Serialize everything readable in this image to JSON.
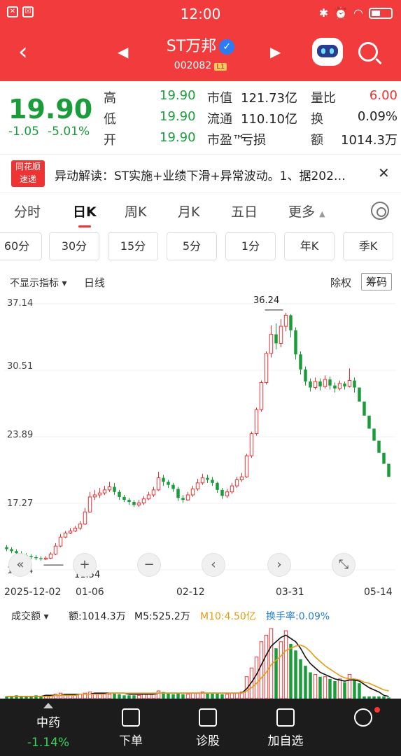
{
  "status_bar": {
    "time": "12:00",
    "left_icons": [
      "✕",
      "☒"
    ],
    "right_icons": [
      "bluetooth-icon",
      "alarm-icon",
      "wifi-icon",
      "battery-icon"
    ]
  },
  "nav": {
    "title": "ST万邦",
    "code": "002082",
    "level": "L1"
  },
  "quote": {
    "price": "19.90",
    "change": "-1.05",
    "change_pct": "-5.01%",
    "rows": [
      {
        "k1": "高",
        "v1": "19.90",
        "k2": "市值",
        "v2": "121.73亿",
        "k3": "量比",
        "v3": "6.00",
        "v3_red": true
      },
      {
        "k1": "低",
        "v1": "19.90",
        "k2": "流通",
        "v2": "110.10亿",
        "k3": "换",
        "v3": "0.09%",
        "v3_red": false
      },
      {
        "k1": "开",
        "v1": "19.90",
        "k2": "市盈™",
        "v2": "亏损",
        "k3": "额",
        "v3": "1014.3万",
        "v3_red": false
      }
    ]
  },
  "news": {
    "logo_top": "同花顺",
    "logo_bottom": "速递",
    "text": "异动解读：ST实施+业绩下滑+异常波动。1、据202…",
    "close": "✕"
  },
  "period_tabs": [
    "分时",
    "日K",
    "周K",
    "月K",
    "五日",
    "更多"
  ],
  "more_caret": "▲",
  "minute_buttons": [
    "60分",
    "30分",
    "15分",
    "5分",
    "1分",
    "年K",
    "季K"
  ],
  "chart_head": {
    "indicator": "不显示指标 ▾",
    "ma": "日线",
    "exright": "除权",
    "chips": "筹码"
  },
  "chart_data": {
    "type": "candlestick",
    "y_ticks": [
      "37.14",
      "30.51",
      "23.89",
      "17.27",
      "10.64"
    ],
    "ylim": [
      10.64,
      37.14
    ],
    "x_ticks": [
      "2025-12-02",
      "01-06",
      "02-12",
      "03-31",
      "05-14"
    ],
    "max_label": "36.24",
    "min_label": "11.54",
    "candles": [
      [
        12.9,
        12.7,
        13.1,
        12.5
      ],
      [
        12.7,
        12.5,
        12.9,
        12.3
      ],
      [
        12.5,
        12.3,
        12.7,
        12.1
      ],
      [
        12.3,
        12.1,
        12.5,
        11.9
      ],
      [
        12.1,
        12.0,
        12.3,
        11.8
      ],
      [
        12.0,
        11.9,
        12.2,
        11.7
      ],
      [
        11.9,
        11.8,
        12.1,
        11.6
      ],
      [
        11.8,
        11.7,
        12.0,
        11.54
      ],
      [
        11.7,
        11.8,
        12.0,
        11.6
      ],
      [
        11.8,
        12.2,
        12.4,
        11.7
      ],
      [
        12.2,
        13.0,
        13.3,
        12.1
      ],
      [
        13.0,
        13.9,
        14.2,
        12.9
      ],
      [
        13.9,
        14.3,
        14.5,
        13.8
      ],
      [
        14.3,
        14.5,
        14.8,
        14.2
      ],
      [
        14.5,
        14.8,
        15.0,
        14.4
      ],
      [
        14.8,
        15.2,
        15.5,
        14.6
      ],
      [
        15.2,
        16.4,
        16.8,
        15.1
      ],
      [
        16.4,
        17.9,
        18.4,
        16.3
      ],
      [
        17.9,
        18.1,
        18.6,
        17.6
      ],
      [
        18.1,
        18.3,
        18.8,
        17.8
      ],
      [
        18.3,
        18.6,
        19.0,
        18.1
      ],
      [
        18.6,
        18.9,
        19.4,
        18.4
      ],
      [
        18.9,
        18.4,
        19.3,
        18.1
      ],
      [
        18.4,
        17.9,
        18.6,
        17.6
      ],
      [
        17.9,
        17.6,
        18.1,
        17.4
      ],
      [
        17.6,
        17.4,
        17.8,
        17.1
      ],
      [
        17.4,
        17.1,
        17.6,
        16.9
      ],
      [
        17.1,
        17.3,
        17.6,
        16.9
      ],
      [
        17.3,
        17.7,
        18.0,
        17.1
      ],
      [
        17.7,
        18.1,
        18.4,
        17.6
      ],
      [
        18.1,
        18.6,
        18.9,
        17.9
      ],
      [
        18.6,
        19.8,
        20.4,
        18.5
      ],
      [
        19.8,
        19.4,
        20.1,
        19.0
      ],
      [
        19.4,
        19.1,
        19.6,
        18.8
      ],
      [
        19.1,
        18.7,
        19.3,
        18.4
      ],
      [
        18.7,
        17.8,
        18.9,
        17.5
      ],
      [
        17.8,
        17.6,
        18.1,
        17.3
      ],
      [
        17.6,
        18.1,
        18.4,
        17.5
      ],
      [
        18.1,
        18.7,
        19.0,
        17.9
      ],
      [
        18.7,
        19.3,
        19.7,
        18.5
      ],
      [
        19.3,
        19.8,
        20.2,
        19.1
      ],
      [
        19.8,
        19.6,
        20.1,
        19.3
      ],
      [
        19.6,
        19.3,
        19.9,
        19.0
      ],
      [
        19.3,
        18.6,
        19.4,
        18.3
      ],
      [
        18.6,
        18.0,
        18.8,
        17.7
      ],
      [
        18.0,
        18.4,
        18.7,
        17.8
      ],
      [
        18.4,
        19.0,
        19.3,
        18.2
      ],
      [
        19.0,
        19.6,
        19.9,
        18.8
      ],
      [
        19.6,
        19.9,
        20.3,
        19.4
      ],
      [
        19.9,
        22.0,
        22.2,
        19.8
      ],
      [
        22.0,
        24.2,
        24.4,
        21.8
      ],
      [
        24.2,
        26.6,
        26.8,
        24.0
      ],
      [
        26.6,
        29.3,
        29.5,
        26.4
      ],
      [
        29.3,
        32.2,
        32.4,
        29.1
      ],
      [
        32.2,
        34.1,
        35.0,
        31.8
      ],
      [
        34.1,
        33.2,
        35.2,
        32.6
      ],
      [
        33.2,
        34.9,
        35.6,
        32.8
      ],
      [
        34.9,
        36.0,
        36.24,
        34.4
      ],
      [
        36.0,
        34.5,
        36.1,
        33.8
      ],
      [
        34.5,
        32.1,
        34.8,
        31.6
      ],
      [
        32.1,
        30.6,
        32.4,
        30.1
      ],
      [
        30.6,
        29.4,
        30.9,
        29.0
      ],
      [
        29.4,
        28.8,
        29.7,
        28.4
      ],
      [
        28.8,
        29.4,
        29.8,
        28.6
      ],
      [
        29.4,
        28.9,
        29.7,
        28.5
      ],
      [
        28.9,
        29.6,
        30.0,
        28.7
      ],
      [
        29.6,
        29.0,
        29.9,
        28.6
      ],
      [
        29.0,
        28.7,
        29.3,
        28.3
      ],
      [
        28.7,
        29.2,
        29.5,
        28.5
      ],
      [
        29.2,
        28.9,
        29.4,
        28.6
      ],
      [
        28.9,
        29.5,
        30.7,
        28.8
      ],
      [
        29.5,
        28.8,
        29.8,
        28.3
      ],
      [
        28.8,
        27.4,
        28.8,
        27.4
      ],
      [
        27.4,
        26.0,
        26.0,
        26.0
      ],
      [
        26.0,
        24.7,
        24.7,
        24.7
      ],
      [
        24.7,
        23.5,
        23.5,
        23.5
      ],
      [
        23.5,
        22.3,
        22.3,
        22.3
      ],
      [
        22.3,
        21.2,
        21.2,
        21.2
      ],
      [
        21.2,
        19.9,
        19.9,
        19.9
      ]
    ],
    "volume": [
      2,
      2,
      3,
      2,
      2,
      2,
      3,
      2,
      3,
      3,
      4,
      5,
      4,
      3,
      3,
      4,
      5,
      6,
      5,
      4,
      4,
      4,
      5,
      4,
      3,
      3,
      3,
      3,
      4,
      4,
      5,
      7,
      6,
      5,
      4,
      5,
      4,
      4,
      5,
      5,
      6,
      5,
      5,
      5,
      4,
      4,
      5,
      5,
      6,
      20,
      28,
      38,
      52,
      58,
      64,
      46,
      52,
      62,
      50,
      44,
      36,
      30,
      24,
      22,
      20,
      20,
      18,
      16,
      18,
      15,
      22,
      18,
      14,
      2,
      2,
      2,
      2,
      2,
      1
    ],
    "ma5": [
      2,
      2,
      2,
      2,
      2,
      2,
      2,
      2,
      3,
      3,
      3,
      3,
      4,
      4,
      4,
      4,
      4,
      4,
      5,
      5,
      5,
      5,
      5,
      5,
      5,
      4,
      4,
      4,
      4,
      4,
      4,
      5,
      5,
      5,
      5,
      5,
      5,
      5,
      5,
      5,
      5,
      5,
      5,
      5,
      5,
      5,
      5,
      5,
      5,
      9,
      15,
      22,
      31,
      40,
      48,
      52,
      56,
      58,
      55,
      52,
      46,
      38,
      32,
      28,
      24,
      22,
      20,
      18,
      17,
      16,
      17,
      17,
      16,
      13,
      10,
      8,
      6,
      3,
      2
    ],
    "ma10": [
      2,
      2,
      2,
      2,
      2,
      2,
      2,
      2,
      2,
      2,
      3,
      3,
      3,
      3,
      3,
      4,
      4,
      4,
      4,
      4,
      4,
      5,
      5,
      5,
      5,
      5,
      5,
      5,
      5,
      5,
      5,
      5,
      5,
      5,
      5,
      5,
      5,
      5,
      5,
      5,
      5,
      5,
      5,
      5,
      5,
      5,
      5,
      5,
      5,
      7,
      10,
      14,
      19,
      24,
      31,
      35,
      39,
      44,
      46,
      48,
      49,
      47,
      43,
      38,
      34,
      30,
      27,
      24,
      21,
      19,
      18,
      18,
      17,
      15,
      14,
      12,
      10,
      8,
      7
    ]
  },
  "vol_head": {
    "label": "成交额 ▾",
    "amount": "额:1014.3万",
    "m5": "M5:525.2万",
    "m10": "M10:4.50亿",
    "turnover": "换手率:0.09%"
  },
  "colors": {
    "up": "#e83232",
    "down": "#1a9c3a",
    "brand": "#f23b3c",
    "m10": "#e69b12",
    "turnover": "#2a7fd6"
  },
  "bottom": {
    "index_name": "中药",
    "index_pct": "-1.14%",
    "items": [
      {
        "label": "下单",
        "icon": "order-icon"
      },
      {
        "label": "诊股",
        "icon": "diagnose-icon"
      },
      {
        "label": "加自选",
        "icon": "add-watchlist-icon"
      },
      {
        "label": "",
        "icon": "menu-icon"
      }
    ]
  }
}
